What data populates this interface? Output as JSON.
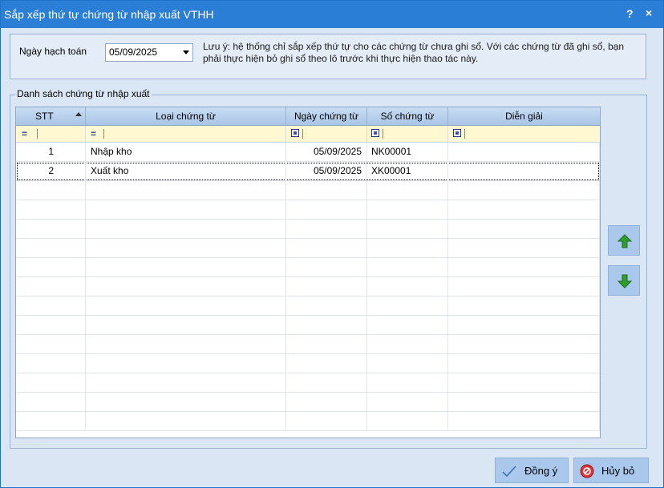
{
  "window": {
    "title": "Sắp xếp thứ tự chứng từ nhập xuất VTHH",
    "help_label": "?",
    "close_label": "×"
  },
  "filter": {
    "date_label": "Ngày hạch toán",
    "date_value": "05/09/2025",
    "note": "Lưu ý: hệ thống chỉ sắp xếp thứ tự cho các chứng từ chưa ghi sổ. Với các chứng từ đã ghi sổ, bạn phải thực hiện bỏ ghi sổ theo lô trước khi thực hiện thao tác này."
  },
  "list": {
    "group_label": "Danh sách chứng từ nhập xuất",
    "columns": [
      "STT",
      "Loại chứng từ",
      "Ngày chứng từ",
      "Số chứng từ",
      "Diễn giải"
    ],
    "rows": [
      {
        "stt": "1",
        "loai": "Nhập kho",
        "ngay": "05/09/2025",
        "so": "NK00001",
        "dien_giai": ""
      },
      {
        "stt": "2",
        "loai": "Xuất kho",
        "ngay": "05/09/2025",
        "so": "XK00001",
        "dien_giai": ""
      }
    ],
    "selected_row": 1
  },
  "icons": {
    "move_up": "arrow-up-icon",
    "move_down": "arrow-down-icon",
    "ok": "checkmark-icon",
    "cancel": "cancel-circle-icon",
    "filter_equals": "equals-icon",
    "filter_box": "filter-box-icon"
  },
  "buttons": {
    "ok_label": "Đồng ý",
    "cancel_label": "Hủy bỏ"
  },
  "colors": {
    "titlebar": "#2b7ed6",
    "window_bg": "#dae6f4",
    "filter_row": "#fff8d0",
    "arrow_green": "#2f9e2f",
    "cancel_red": "#d9343a"
  }
}
